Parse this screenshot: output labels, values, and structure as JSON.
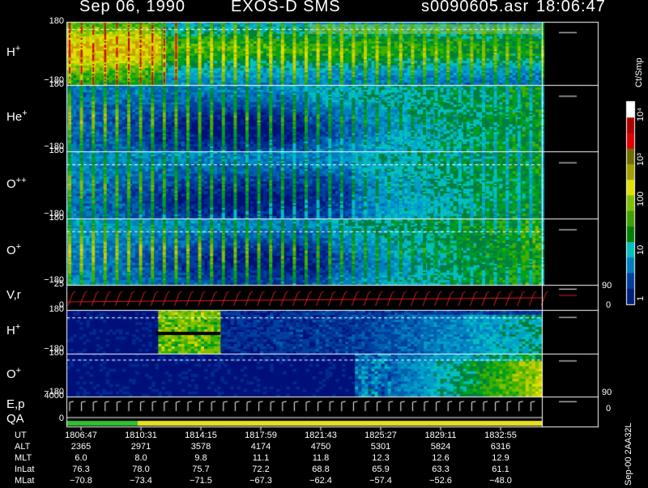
{
  "header": {
    "date": "Sep 06, 1990",
    "instrument": "EXOS-D SMS",
    "file": "s0090605.asr",
    "time": "18:06:47"
  },
  "panels": [
    {
      "id": "h-plus-1",
      "label": "H",
      "sup": "+",
      "ymax": "180",
      "ymin": "−180"
    },
    {
      "id": "he-plus",
      "label": "He",
      "sup": "+",
      "ymax": "180",
      "ymin": "−180"
    },
    {
      "id": "o-plus-plus",
      "label": "O",
      "sup": "++",
      "ymax": "180",
      "ymin": "−180"
    },
    {
      "id": "o-plus-1",
      "label": "O",
      "sup": "+",
      "ymax": "180",
      "ymin": "−180"
    },
    {
      "id": "vr",
      "label": "V,r",
      "sup": "",
      "ymax": "25",
      "ymin": "0",
      "right_top": "90",
      "right_bot": "0"
    },
    {
      "id": "h-plus-2",
      "label": "H",
      "sup": "+",
      "ymax": "180",
      "ymin": "−180"
    },
    {
      "id": "o-plus-2",
      "label": "O",
      "sup": "+",
      "ymax": "180",
      "ymin": "−180"
    },
    {
      "id": "ep-qa",
      "label": "E,p",
      "label2": "QA",
      "sup": "",
      "ymax": "4000",
      "ymin": "0",
      "right_top": "90",
      "right_bot": "0"
    }
  ],
  "colorbar": {
    "unit": "Ct/Smp",
    "ticks": [
      "10⁴",
      "10³",
      "100",
      "10",
      "1"
    ],
    "colors": [
      "#ffffff",
      "#b00000",
      "#e00000",
      "#707000",
      "#a0a000",
      "#e0e000",
      "#80c000",
      "#40a000",
      "#008000",
      "#00c0c0",
      "#0080c0",
      "#0040a0",
      "#002080"
    ]
  },
  "chart_data": {
    "type": "heatmap",
    "title": "Sep 06, 1990  EXOS-D SMS",
    "x_ticks": [
      "1806:47",
      "1810:31",
      "1814:15",
      "1817:59",
      "1821:43",
      "1825:27",
      "1829:11",
      "1832:55"
    ],
    "y_range": [
      -180,
      180
    ],
    "colorbar_unit": "Ct/Smp",
    "colorbar_range": [
      1,
      10000
    ],
    "scale": "log"
  },
  "ephemeris": [
    {
      "name": "UT",
      "values": [
        "1806:47",
        "1810:31",
        "1814:15",
        "1817:59",
        "1821:43",
        "1825:27",
        "1829:11",
        "1832:55"
      ]
    },
    {
      "name": "ALT",
      "values": [
        "2365",
        "2971",
        "3578",
        "4174",
        "4750",
        "5301",
        "5824",
        "6316"
      ]
    },
    {
      "name": "MLT",
      "values": [
        "6.0",
        "8.0",
        "9.8",
        "11.1",
        "11.8",
        "12.3",
        "12.6",
        "12.9"
      ]
    },
    {
      "name": "InLat",
      "values": [
        "76.3",
        "78.0",
        "75.7",
        "72.2",
        "68.8",
        "65.9",
        "63.3",
        "61.1"
      ]
    },
    {
      "name": "MLat",
      "values": [
        "−70.8",
        "−73.4",
        "−71.5",
        "−67.3",
        "−62.4",
        "−57.4",
        "−52.6",
        "−48.0"
      ]
    }
  ],
  "side_label": "Sep-00 2AA32L"
}
